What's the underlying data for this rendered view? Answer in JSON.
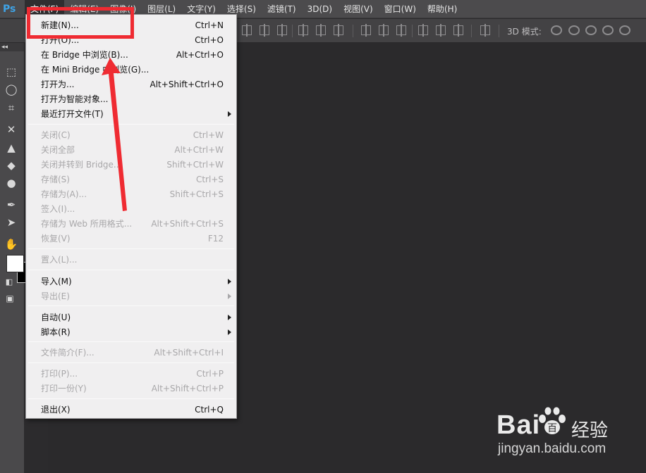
{
  "app": {
    "logo_text": "Ps"
  },
  "menubar": {
    "items": [
      {
        "label": "文件(F)"
      },
      {
        "label": "编辑(E)"
      },
      {
        "label": "图像(I)"
      },
      {
        "label": "图层(L)"
      },
      {
        "label": "文字(Y)"
      },
      {
        "label": "选择(S)"
      },
      {
        "label": "滤镜(T)"
      },
      {
        "label": "3D(D)"
      },
      {
        "label": "视图(V)"
      },
      {
        "label": "窗口(W)"
      },
      {
        "label": "帮助(H)"
      }
    ]
  },
  "optionsbar": {
    "mode_label": "3D 模式:"
  },
  "toolbox": {
    "collapse_glyph": "◂◂"
  },
  "file_menu": {
    "items": [
      {
        "label": "新建(N)...",
        "shortcut": "Ctrl+N",
        "enabled": true
      },
      {
        "label": "打开(O)...",
        "shortcut": "Ctrl+O",
        "enabled": true
      },
      {
        "label": "在 Bridge 中浏览(B)...",
        "shortcut": "Alt+Ctrl+O",
        "enabled": true
      },
      {
        "label": "在 Mini Bridge 中浏览(G)...",
        "shortcut": "",
        "enabled": true
      },
      {
        "label": "打开为...",
        "shortcut": "Alt+Shift+Ctrl+O",
        "enabled": true
      },
      {
        "label": "打开为智能对象...",
        "shortcut": "",
        "enabled": true
      },
      {
        "label": "最近打开文件(T)",
        "shortcut": "",
        "enabled": true,
        "submenu": true
      },
      {
        "label": "关闭(C)",
        "shortcut": "Ctrl+W",
        "enabled": false
      },
      {
        "label": "关闭全部",
        "shortcut": "Alt+Ctrl+W",
        "enabled": false
      },
      {
        "label": "关闭并转到 Bridge...",
        "shortcut": "Shift+Ctrl+W",
        "enabled": false
      },
      {
        "label": "存储(S)",
        "shortcut": "Ctrl+S",
        "enabled": false
      },
      {
        "label": "存储为(A)...",
        "shortcut": "Shift+Ctrl+S",
        "enabled": false
      },
      {
        "label": "签入(I)...",
        "shortcut": "",
        "enabled": false
      },
      {
        "label": "存储为 Web 所用格式...",
        "shortcut": "Alt+Shift+Ctrl+S",
        "enabled": false
      },
      {
        "label": "恢复(V)",
        "shortcut": "F12",
        "enabled": false
      },
      {
        "label": "置入(L)...",
        "shortcut": "",
        "enabled": false
      },
      {
        "label": "导入(M)",
        "shortcut": "",
        "enabled": true,
        "submenu": true
      },
      {
        "label": "导出(E)",
        "shortcut": "",
        "enabled": false,
        "submenu": true
      },
      {
        "label": "自动(U)",
        "shortcut": "",
        "enabled": true,
        "submenu": true
      },
      {
        "label": "脚本(R)",
        "shortcut": "",
        "enabled": true,
        "submenu": true
      },
      {
        "label": "文件简介(F)...",
        "shortcut": "Alt+Shift+Ctrl+I",
        "enabled": false
      },
      {
        "label": "打印(P)...",
        "shortcut": "Ctrl+P",
        "enabled": false
      },
      {
        "label": "打印一份(Y)",
        "shortcut": "Alt+Shift+Ctrl+P",
        "enabled": false
      },
      {
        "label": "退出(X)",
        "shortcut": "Ctrl+Q",
        "enabled": true
      }
    ]
  },
  "annotation": {
    "highlight_color": "#ef2b32",
    "arrow_color": "#ef2b32"
  },
  "watermark": {
    "logo_text": "Bai",
    "logo_suffix": "百",
    "brand_text": "经验",
    "url_text": "jingyan.baidu.com"
  }
}
